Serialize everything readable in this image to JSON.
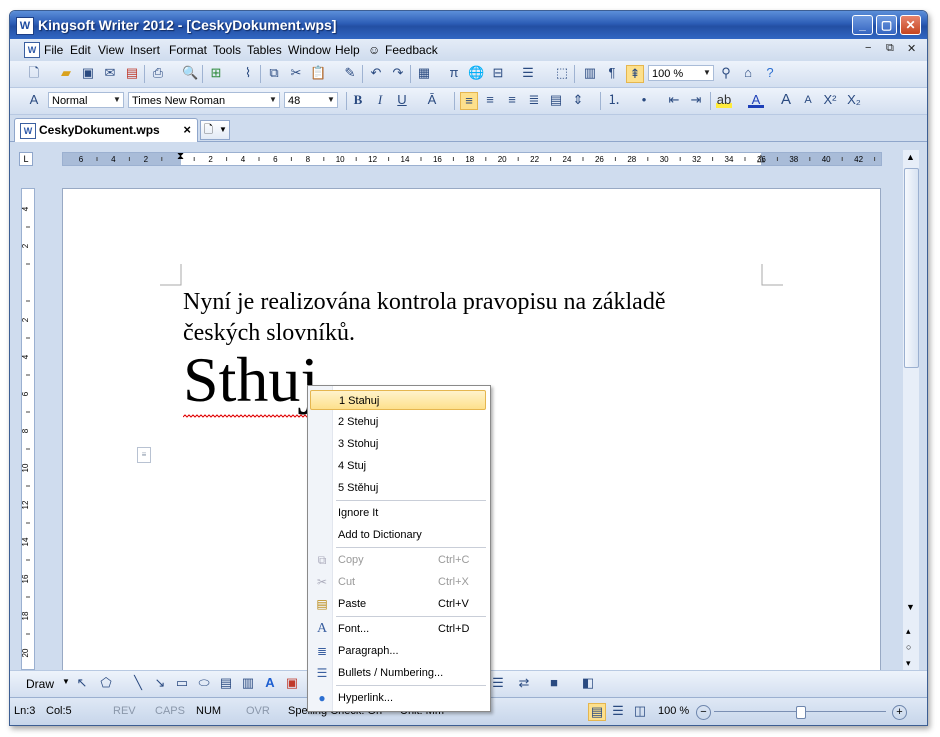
{
  "window": {
    "title": "Kingsoft Writer 2012 - [CeskyDokument.wps]",
    "app_icon": "W",
    "controls": [
      "minimize",
      "maximize",
      "close"
    ]
  },
  "menubar": {
    "items": [
      "File",
      "Edit",
      "View",
      "Insert",
      "Format",
      "Tools",
      "Tables",
      "Window",
      "Help",
      "Feedback"
    ],
    "doc_controls": [
      "−",
      "⧉",
      "✕"
    ]
  },
  "toolbar_standard": {
    "zoom": "100 %"
  },
  "toolbar_format": {
    "style": "Normal",
    "font": "Times New Roman",
    "size": "48"
  },
  "tabs": {
    "document_tab": "CeskyDokument.wps",
    "close": "×"
  },
  "ruler": {
    "h_labels": [
      "6",
      "4",
      "2",
      "",
      "2",
      "4",
      "6",
      "8",
      "10",
      "12",
      "14",
      "16",
      "18",
      "20",
      "22",
      "24",
      "26",
      "28",
      "30",
      "32",
      "34",
      "36",
      "38",
      "40",
      "42"
    ],
    "v_labels": [
      "4",
      "2",
      "",
      "2",
      "4",
      "6",
      "8",
      "10",
      "12",
      "14",
      "16",
      "18",
      "20"
    ]
  },
  "document": {
    "line1": "Nyní je realizována kontrola pravopisu na základě",
    "line2": "českých slovníků.",
    "misspelled": "Sthuj"
  },
  "context_menu": {
    "suggestions": [
      "1 Stahuj",
      "2 Stehuj",
      "3 Stohuj",
      "4 Stuj",
      "5 Stěhuj"
    ],
    "ignore": "Ignore It",
    "add_dict": "Add to Dictionary",
    "copy": {
      "label": "Copy",
      "shortcut": "Ctrl+C"
    },
    "cut": {
      "label": "Cut",
      "shortcut": "Ctrl+X"
    },
    "paste": {
      "label": "Paste",
      "shortcut": "Ctrl+V"
    },
    "font": {
      "label": "Font...",
      "shortcut": "Ctrl+D"
    },
    "paragraph": "Paragraph...",
    "bullets": "Bullets / Numbering...",
    "hyperlink": "Hyperlink..."
  },
  "drawbar": {
    "draw": "Draw"
  },
  "status": {
    "line": "Ln:3",
    "col": "Col:5",
    "rev": "REV",
    "caps": "CAPS",
    "num": "NUM",
    "ovr": "OVR",
    "spell": "Spelling Check: On",
    "unit": "Unit: Mm",
    "zoom": "100 %"
  },
  "colors": {
    "title_bar": "#2c5db6",
    "highlight": "#fde08c",
    "squiggle": "#e00000"
  }
}
